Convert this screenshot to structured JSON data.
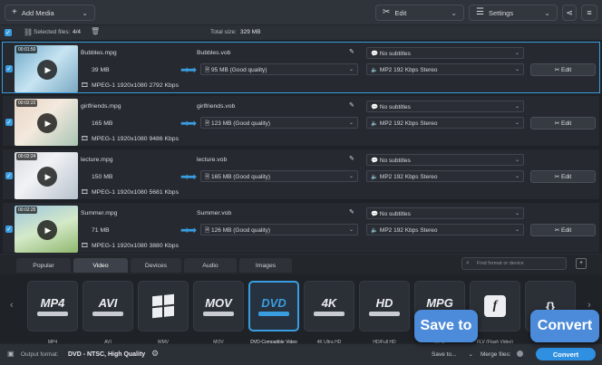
{
  "toolbar": {
    "add_media": "Add Media",
    "edit": "Edit",
    "settings": "Settings"
  },
  "subbar": {
    "selected_label": "Selected files:",
    "selected_value": "4/4",
    "total_label": "Total size:",
    "total_value": "329 MB"
  },
  "files": [
    {
      "time": "00:01:50",
      "name": "Bubbles.mpg",
      "size": "39 MB",
      "info": "MPEG-1 1920x1080 2792 Kbps",
      "out_name": "Bubbles.vob",
      "out_size": "95 MB (Good quality)",
      "subtitles": "No subtitles",
      "audio": "MP2 192 Kbps Stereo",
      "edit": "Edit"
    },
    {
      "time": "00:02:22",
      "name": "girlfriends.mpg",
      "size": "165 MB",
      "info": "MPEG-1 1920x1080 9486 Kbps",
      "out_name": "girlfriends.vob",
      "out_size": "123 MB (Good quality)",
      "subtitles": "No subtitles",
      "audio": "MP2 192 Kbps Stereo",
      "edit": "Edit"
    },
    {
      "time": "00:02:24",
      "name": "lecture.mpg",
      "size": "150 MB",
      "info": "MPEG-1 1920x1080 5681 Kbps",
      "out_name": "lecture.vob",
      "out_size": "165 MB (Good quality)",
      "subtitles": "No subtitles",
      "audio": "MP2 192 Kbps Stereo",
      "edit": "Edit"
    },
    {
      "time": "00:02:25",
      "name": "Summer.mpg",
      "size": "71 MB",
      "info": "MPEG-1 1920x1080 3880 Kbps",
      "out_name": "Summer.vob",
      "out_size": "126 MB (Good quality)",
      "subtitles": "No subtitles",
      "audio": "MP2 192 Kbps Stereo",
      "edit": "Edit"
    }
  ],
  "tabs": [
    "Popular",
    "Video",
    "Devices",
    "Audio",
    "Images"
  ],
  "search_placeholder": "Find format or device",
  "formats": [
    {
      "logo": "MP4",
      "caption": "MP4"
    },
    {
      "logo": "AVI",
      "caption": "AVI"
    },
    {
      "logo": "",
      "caption": "WMV"
    },
    {
      "logo": "MOV",
      "caption": "MOV"
    },
    {
      "logo": "DVD",
      "caption": "DVD-Compatible Video"
    },
    {
      "logo": "4K",
      "caption": "4K Ultra HD"
    },
    {
      "logo": "HD",
      "caption": "HD/Full HD"
    },
    {
      "logo": "MPG",
      "caption": "MPG"
    },
    {
      "logo": "f",
      "caption": "FLV (Flash Video)"
    },
    {
      "logo": "{}",
      "caption": ""
    }
  ],
  "bottom": {
    "output_label": "Output format:",
    "output_value": "DVD - NTSC, High Quality",
    "save_to": "Save to...",
    "merge": "Merge files:",
    "convert": "Convert"
  },
  "tooltips": {
    "save_to": "Save to",
    "convert": "Convert"
  },
  "colors": {
    "accent": "#3a9de0",
    "tooltip": "#4c8bd9"
  }
}
